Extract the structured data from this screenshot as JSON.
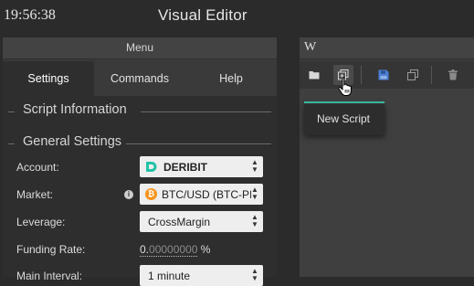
{
  "status": {
    "time": "19:56:38"
  },
  "app": {
    "title": "Visual Editor"
  },
  "menu_panel": {
    "title": "Menu",
    "tabs": [
      {
        "label": "Settings",
        "active": true
      },
      {
        "label": "Commands",
        "active": false
      },
      {
        "label": "Help",
        "active": false
      }
    ],
    "sections": {
      "script_information": "Script Information",
      "general_settings": "General Settings"
    },
    "fields": {
      "account": {
        "label": "Account:",
        "value": "DERIBIT",
        "icon": "deribit-logo-icon"
      },
      "market": {
        "label": "Market:",
        "value": "BTC/USD (BTC-PI",
        "icon": "bitcoin-icon",
        "info_icon": "info-icon"
      },
      "leverage": {
        "label": "Leverage:",
        "value": "CrossMargin"
      },
      "funding_rate": {
        "label": "Funding Rate:",
        "value_integer": "0.",
        "value_decimals": "00000000",
        "unit": "%"
      },
      "main_interval": {
        "label": "Main Interval:",
        "value": "1 minute"
      }
    }
  },
  "editor_panel": {
    "title": "W",
    "toolbar": [
      {
        "name": "open-folder-icon"
      },
      {
        "name": "new-script-icon"
      },
      {
        "name": "save-icon"
      },
      {
        "name": "copy-icon"
      },
      {
        "name": "delete-icon"
      }
    ],
    "tooltip": {
      "text": "New Script"
    }
  },
  "colors": {
    "accent": "#3dbfa6",
    "deribit": "#21c3a7",
    "bitcoin": "#f7931a",
    "save_blue": "#4a7fd6"
  }
}
